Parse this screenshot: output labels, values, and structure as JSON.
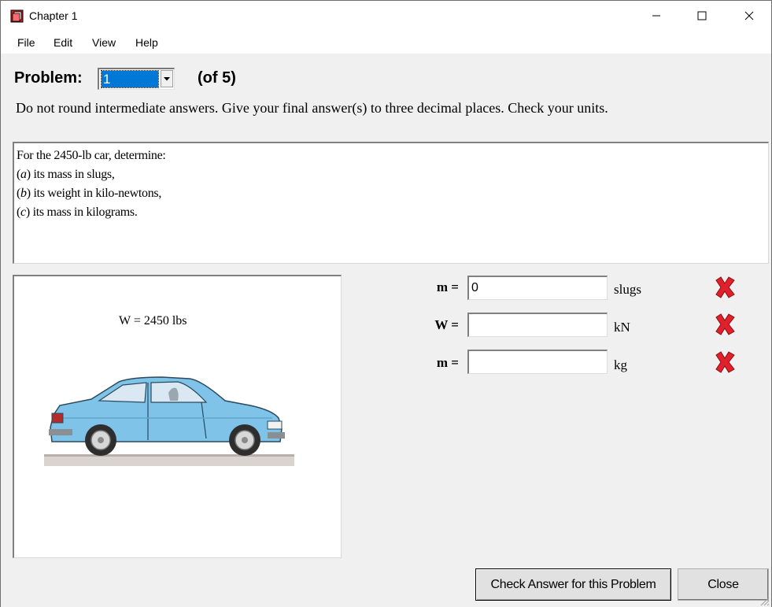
{
  "window": {
    "title": "Chapter 1",
    "icon": "book-icon",
    "controls": [
      "minimize-icon",
      "maximize-icon",
      "close-icon"
    ]
  },
  "menu": {
    "items": [
      "File",
      "Edit",
      "View",
      "Help"
    ]
  },
  "problem": {
    "label": "Problem:",
    "selected": "1",
    "count_text": "(of 5)"
  },
  "instructions": "Do not round intermediate answers.  Give your final answer(s) to three decimal places.  Check your units.",
  "question": {
    "intro": "For the 2450-lb car, determine:",
    "parts": [
      {
        "letter": "a",
        "text": " its mass in slugs,"
      },
      {
        "letter": "b",
        "text": " its weight in kilo-newtons,"
      },
      {
        "letter": "c",
        "text": " its mass in kilograms."
      }
    ]
  },
  "figure": {
    "caption": "W = 2450 lbs",
    "image": "car-illustration"
  },
  "answers": [
    {
      "label": "m =",
      "value": "0",
      "unit": "slugs",
      "status": "incorrect"
    },
    {
      "label": "W =",
      "value": "",
      "unit": "kN",
      "status": "incorrect"
    },
    {
      "label": "m =",
      "value": "",
      "unit": "kg",
      "status": "incorrect"
    }
  ],
  "buttons": {
    "check": "Check Answer for this Problem",
    "close": "Close"
  },
  "colors": {
    "selection": "#0078d7",
    "status_x": "#e0212b",
    "car_body": "#7fc4e8"
  }
}
